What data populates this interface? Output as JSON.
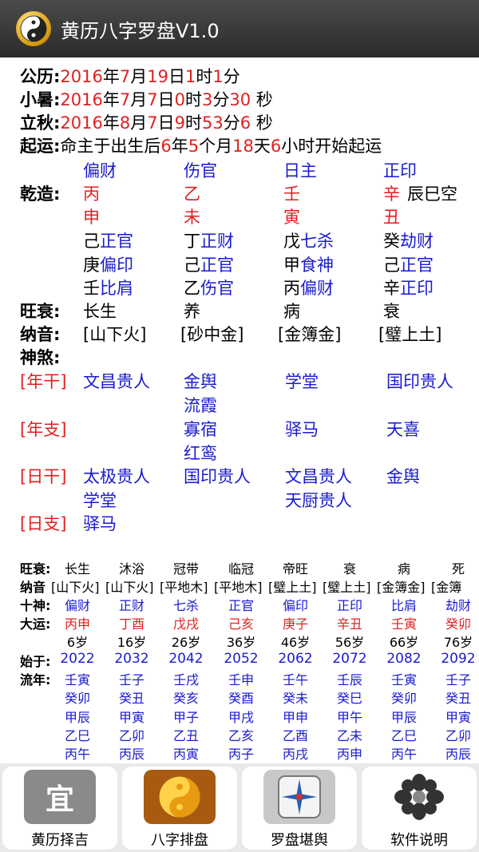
{
  "app": {
    "title": "黄历八字罗盘V1.0"
  },
  "header": {
    "gongli": {
      "label": "公历:",
      "year": "2016",
      "month": "7",
      "day": "19",
      "hour": "1",
      "minute": "1"
    },
    "xiaoshu": {
      "label": "小暑:",
      "year": "2016",
      "month": "7",
      "day": "7",
      "hour": "0",
      "minute": "3",
      "second": "30"
    },
    "liqiu": {
      "label": "立秋:",
      "year": "2016",
      "month": "8",
      "day": "7",
      "hour": "9",
      "minute": "53",
      "second": "6"
    },
    "qiyun": {
      "label": "起运:",
      "prefix": "命主于出生后",
      "years": "6",
      "months": "5",
      "days": "18",
      "hours": "6",
      "suffix": "小时开始起运"
    }
  },
  "units": {
    "nian": "年",
    "yue": "月",
    "ri": "日",
    "shi": "时",
    "fen": "分",
    "miao": " 秒",
    "ge_yue": "个月",
    "tian": "天"
  },
  "bazi": {
    "label": "乾造:",
    "shishen": [
      "偏财",
      "伤官",
      "日主",
      "正印"
    ],
    "gan": [
      "丙",
      "乙",
      "壬",
      "辛"
    ],
    "kong": "辰巳空",
    "zhi": [
      "申",
      "未",
      "寅",
      "丑"
    ],
    "canggan": [
      [
        [
          "己",
          "正官"
        ],
        [
          "庚",
          "偏印"
        ],
        [
          "壬",
          "比肩"
        ]
      ],
      [
        [
          "丁",
          "正财"
        ],
        [
          "己",
          "正官"
        ],
        [
          "乙",
          "伤官"
        ]
      ],
      [
        [
          "戊",
          "七杀"
        ],
        [
          "甲",
          "食神"
        ],
        [
          "丙",
          "偏财"
        ]
      ],
      [
        [
          "癸",
          "劫财"
        ],
        [
          "己",
          "正官"
        ],
        [
          "辛",
          "正印"
        ]
      ]
    ],
    "wangshuai_label": "旺衰:",
    "wangshuai": [
      "长生",
      "养",
      "病",
      "衰"
    ],
    "nayin_label": "纳音:",
    "nayin": [
      "[山下火]",
      "[砂中金]",
      "[金簿金]",
      "[璧上土]"
    ],
    "shensha_label": "神煞:"
  },
  "shensha": {
    "niangan": {
      "label": "[年干]",
      "cols": [
        [
          "文昌贵人"
        ],
        [
          "金舆",
          "流霞"
        ],
        [
          "学堂"
        ],
        [
          "国印贵人"
        ]
      ]
    },
    "nianzhi": {
      "label": "[年支]",
      "cols": [
        [],
        [
          "寡宿",
          "红鸾"
        ],
        [
          "驿马"
        ],
        [
          "天喜"
        ]
      ]
    },
    "rigan": {
      "label": "[日干]",
      "cols": [
        [
          "太极贵人",
          "学堂"
        ],
        [
          "国印贵人"
        ],
        [
          "文昌贵人",
          "天厨贵人"
        ],
        [
          "金舆"
        ]
      ]
    },
    "rizhi": {
      "label": "[日支]",
      "cols": [
        [
          "驿马"
        ],
        [],
        [],
        []
      ]
    }
  },
  "dayun": {
    "wangshuai_label": "旺衰:",
    "wangshuai": [
      "长生",
      "沐浴",
      "冠带",
      "临冠",
      "帝旺",
      "衰",
      "病",
      "死"
    ],
    "nayin_label": "纳音",
    "nayin": [
      "[山下火]",
      "[山下火]",
      "[平地木]",
      "[平地木]",
      "[璧上土]",
      "[璧上土]",
      "[金簿金]",
      "[金簿"
    ],
    "shishen_label": "十神:",
    "shishen": [
      "偏财",
      "正财",
      "七杀",
      "正官",
      "偏印",
      "正印",
      "比肩",
      "劫财"
    ],
    "dayun_label": "大运:",
    "ganzhi": [
      "丙申",
      "丁酉",
      "戊戌",
      "己亥",
      "庚子",
      "辛丑",
      "壬寅",
      "癸卯"
    ],
    "ages": [
      "6岁",
      "16岁",
      "26岁",
      "36岁",
      "46岁",
      "56岁",
      "66岁",
      "76岁"
    ],
    "shiyu_label": "始于:",
    "years": [
      "2022",
      "2032",
      "2042",
      "2052",
      "2062",
      "2072",
      "2082",
      "2092"
    ],
    "liunian_label": "流年:",
    "liunian": [
      [
        "壬寅",
        "壬子",
        "壬戌",
        "壬申",
        "壬午",
        "壬辰",
        "壬寅",
        "壬子"
      ],
      [
        "癸卯",
        "癸丑",
        "癸亥",
        "癸酉",
        "癸未",
        "癸巳",
        "癸卯",
        "癸丑"
      ],
      [
        "甲辰",
        "甲寅",
        "甲子",
        "甲戌",
        "甲申",
        "甲午",
        "甲辰",
        "甲寅"
      ],
      [
        "乙巳",
        "乙卯",
        "乙丑",
        "乙亥",
        "乙酉",
        "乙未",
        "乙巳",
        "乙卯"
      ],
      [
        "丙午",
        "丙辰",
        "丙寅",
        "丙子",
        "丙戌",
        "丙申",
        "丙午",
        "丙辰"
      ]
    ]
  },
  "tabs": [
    {
      "label": "黄历择吉",
      "icon": "calendar-icon",
      "icon_glyph": "宜",
      "bg": "#8a8a8a"
    },
    {
      "label": "八字排盘",
      "icon": "yinyang-icon",
      "icon_glyph": "☯",
      "bg": "#a85a10"
    },
    {
      "label": "罗盘堪舆",
      "icon": "compass-icon",
      "icon_glyph": "✦",
      "bg": "#b8b8b8"
    },
    {
      "label": "软件说明",
      "icon": "flower-icon",
      "icon_glyph": "✿",
      "bg": "#ffffff"
    }
  ],
  "colors": {
    "red": "#e02020",
    "blue": "#1a1ad0",
    "titlebar": "#333333",
    "bottombar": "#e9e9e9"
  }
}
